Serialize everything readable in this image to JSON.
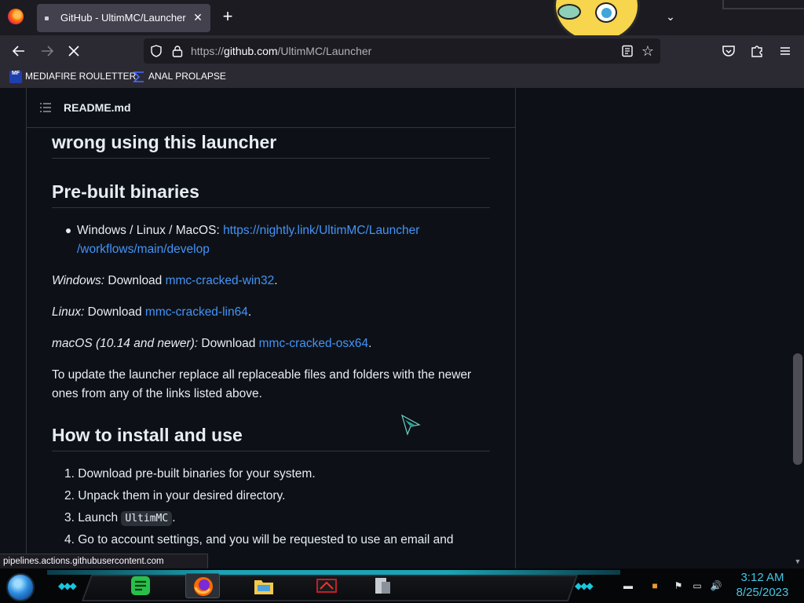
{
  "browser": {
    "tab_title": "GitHub - UltimMC/Launcher: C",
    "url_prefix": "https://",
    "url_host": "github.com",
    "url_path": "/UltimMC/Launcher",
    "bookmarks": [
      {
        "label": "MEDIAFIRE ROULETTER",
        "icon_text": "MF"
      },
      {
        "label": "ANAL PROLAPSE"
      }
    ]
  },
  "readme": {
    "file_name": "README.md",
    "heading_cut": "wrong using this launcher",
    "prebuilt_heading": "Pre-built binaries",
    "bullet_prefix": "Windows / Linux / MacOS: ",
    "bullet_link_1": "https://nightly.link/UltimMC/Launcher",
    "bullet_link_2": "/workflows/main/develop",
    "win_label": "Windows:",
    "win_text": " Download ",
    "win_link": "mmc-cracked-win32",
    "linux_label": "Linux:",
    "linux_text": " Download ",
    "linux_link": "mmc-cracked-lin64",
    "mac_label": "macOS (10.14 and newer):",
    "mac_text": " Download ",
    "mac_link": "mmc-cracked-osx64",
    "period": ".",
    "update_line_1": "To update the launcher replace all replaceable files and folders with the newer",
    "update_line_2": "ones from any of the links listed above.",
    "install_heading": "How to install and use",
    "steps": [
      {
        "num": "1.",
        "text": "Download pre-built binaries for your system."
      },
      {
        "num": "2.",
        "text": "Unpack them in your desired directory."
      },
      {
        "num": "3.",
        "text": "Launch ",
        "code": "UltimMC",
        "after": "."
      },
      {
        "num": "4.",
        "text": "Go to account settings, and you will be requested to use an email and"
      }
    ]
  },
  "status_url": "pipelines.actions.githubusercontent.com",
  "taskbar": {
    "time": "3:12 AM",
    "date": "8/25/2023"
  },
  "colors": {
    "link": "#4493f8",
    "accent": "#19c6de",
    "page_bg": "#0d1117"
  }
}
